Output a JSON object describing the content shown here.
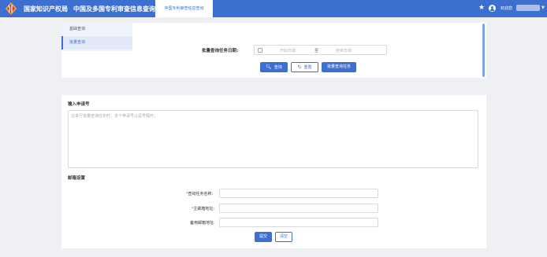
{
  "header": {
    "org_name": "国家知识产权局",
    "system_name": "中国及多国专利审查信息查询",
    "active_tab": "中国专利审查信息查询",
    "welcome": "欢迎您",
    "star_icon": "star-icon",
    "user_icon": "user-icon",
    "accent_color": "#3d6fd0"
  },
  "sidebar": {
    "items": [
      {
        "label": "基础查询"
      },
      {
        "label": "批量查询"
      }
    ]
  },
  "batch_query": {
    "date_label": "批量查询任务日期:",
    "date_start_placeholder": "开始日期",
    "date_separator": "至",
    "date_end_placeholder": "结束日期",
    "search_button": "查询",
    "reset_button": "重置",
    "batch_task_button": "批量查询任务"
  },
  "input_section": {
    "title": "输入申请号",
    "textarea_placeholder": "在进行批量查询任务时，多个申请号以逗号隔开。"
  },
  "email_section": {
    "title": "邮箱设置",
    "task_name_label": "查询任务名称:",
    "main_email_label": "主邮箱地址:",
    "backup_email_label": "备用邮箱地址:",
    "required_mark": "*",
    "submit_button": "提交",
    "clear_button": "清空"
  }
}
